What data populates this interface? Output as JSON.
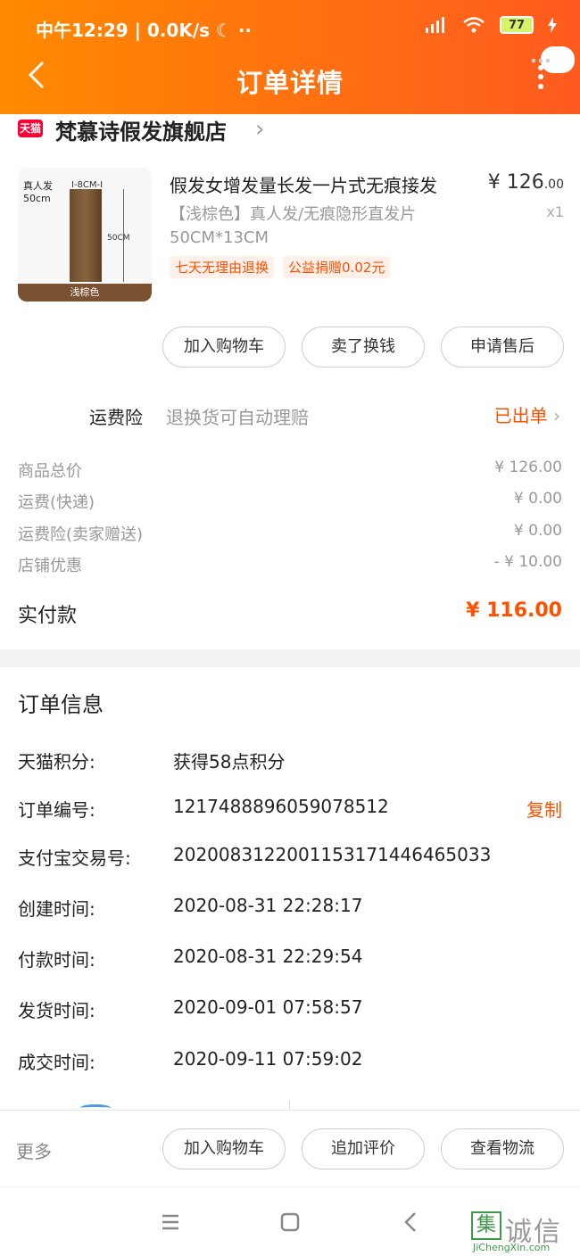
{
  "status_bar": {
    "left": "中午12:29 | 0.0K/s ☾  ··",
    "battery": "77"
  },
  "header": {
    "title": "订单详情"
  },
  "shop": {
    "badge": "天猫",
    "name": "梵慕诗假发旗舰店"
  },
  "product": {
    "title": "假发女增发量长发一片式无痕接发",
    "spec": "【浅棕色】真人发/无痕隐形直发片 50CM*13CM",
    "thumb_label1": "真人发",
    "thumb_label2": "50cm",
    "thumb_top": "I-8CM-I",
    "thumb_measure": "50CM",
    "thumb_color": "浅棕色",
    "price_main": "¥ 126",
    "price_cents": ".00",
    "qty": "x1",
    "tags": [
      "七天无理由退换",
      "公益捐赠0.02元"
    ]
  },
  "product_buttons": [
    "加入购物车",
    "卖了换钱",
    "申请售后"
  ],
  "insurance": {
    "label": "运费险",
    "desc": "退换货可自动理赔",
    "status": "已出单"
  },
  "costs": [
    {
      "label": "商品总价",
      "value": "¥ 126.00"
    },
    {
      "label": "运费(快递)",
      "value": "¥ 0.00"
    },
    {
      "label": "运费险(卖家赠送)",
      "value": "¥ 0.00"
    },
    {
      "label": "店铺优惠",
      "value": "- ¥ 10.00"
    }
  ],
  "paid": {
    "label": "实付款",
    "value": "¥ 116.00"
  },
  "order_info": {
    "title": "订单信息",
    "rows": [
      {
        "k": "天猫积分:",
        "v": "获得58点积分"
      },
      {
        "k": "订单编号:",
        "v": "1217488896059078512"
      },
      {
        "k": "支付宝交易号:",
        "v": "2020083122001153171446465033"
      },
      {
        "k": "创建时间:",
        "v": "2020-08-31 22:28:17"
      },
      {
        "k": "付款时间:",
        "v": "2020-08-31 22:29:54"
      },
      {
        "k": "发货时间:",
        "v": "2020-09-01 07:58:57"
      },
      {
        "k": "成交时间:",
        "v": "2020-09-11 07:59:02"
      }
    ],
    "copy_label": "复制"
  },
  "bottom_bar": {
    "more": "更多",
    "buttons": [
      "加入购物车",
      "追加评价",
      "查看物流"
    ]
  },
  "watermark": {
    "box": "集",
    "text": "诚信",
    "sub": "JiChengXin.com"
  },
  "colors": {
    "accent": "#ff5000",
    "header_start": "#ff8a00",
    "header_end": "#ff5a1f"
  }
}
